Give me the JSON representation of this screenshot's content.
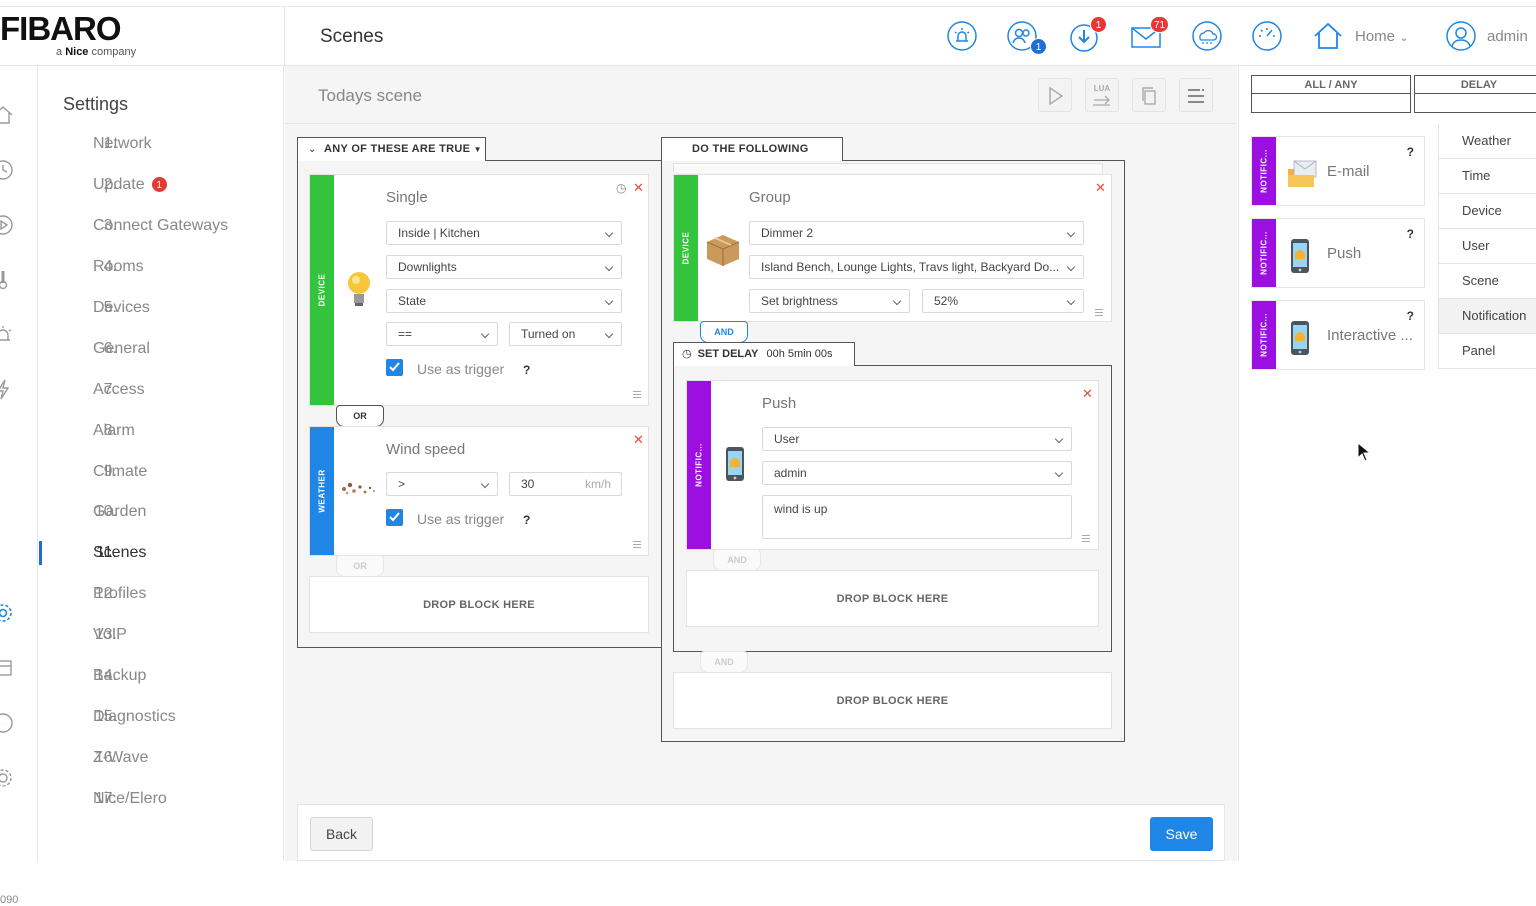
{
  "header": {
    "brand": "FIBARO",
    "brand_sub_prefix": "a ",
    "brand_sub_strong": "Nice",
    "brand_sub_suffix": " company",
    "page_title": "Scenes",
    "icons": [
      "alarm-icon",
      "users-icon",
      "download-icon",
      "mail-icon",
      "weather-icon",
      "gauge-icon",
      "home-icon",
      "user-icon"
    ],
    "users_badge": "1",
    "download_badge": "1",
    "mail_badge": "71",
    "home_label": "Home",
    "user_label": "admin"
  },
  "icon_strip": {
    "icons": [
      "home-icon",
      "clock-icon",
      "scene-icon",
      "thermometer-icon",
      "alarm-icon",
      "energy-icon",
      "settings-icon",
      "panel-icon",
      "chat-icon",
      "gear-icon"
    ],
    "footer_text": "090"
  },
  "settings": {
    "title": "Settings",
    "items": [
      {
        "num": "1.",
        "label": "Network"
      },
      {
        "num": "2.",
        "label": "Update",
        "badge": "1"
      },
      {
        "num": "3.",
        "label": "Connect Gateways"
      },
      {
        "num": "4.",
        "label": "Rooms"
      },
      {
        "num": "5.",
        "label": "Devices"
      },
      {
        "num": "6.",
        "label": "General"
      },
      {
        "num": "7.",
        "label": "Access"
      },
      {
        "num": "8.",
        "label": "Alarm"
      },
      {
        "num": "9.",
        "label": "Climate"
      },
      {
        "num": "10.",
        "label": "Garden"
      },
      {
        "num": "11.",
        "label": "Scenes"
      },
      {
        "num": "12.",
        "label": "Profiles"
      },
      {
        "num": "13.",
        "label": "VoIP"
      },
      {
        "num": "14.",
        "label": "Backup"
      },
      {
        "num": "15.",
        "label": "Diagnostics"
      },
      {
        "num": "16.",
        "label": "Z-Wave"
      },
      {
        "num": "17.",
        "label": "Nice/Elero"
      }
    ],
    "active_index": 10
  },
  "scene": {
    "name": "Todays scene",
    "tools": [
      "play-icon",
      "lua-icon",
      "copy-icon",
      "list-icon"
    ],
    "lua_label": "LUA"
  },
  "conditions": {
    "header": "ANY OF THESE ARE TRUE",
    "device_block": {
      "stripe": "DEVICE",
      "title": "Single",
      "room": "Inside | Kitchen",
      "device": "Downlights",
      "property": "State",
      "operator": "==",
      "value": "Turned on",
      "trigger_label": "Use as trigger",
      "help": "?"
    },
    "or_label": "OR",
    "weather_block": {
      "stripe": "WEATHER",
      "title": "Wind speed",
      "operator": ">",
      "value": "30",
      "unit": "km/h",
      "trigger_label": "Use as trigger",
      "help": "?"
    },
    "faded_or_label": "OR",
    "drop_label": "DROP BLOCK HERE"
  },
  "actions": {
    "header": "DO THE FOLLOWING",
    "group_block": {
      "stripe": "DEVICE",
      "title": "Group",
      "type": "Dimmer 2",
      "devices": "Island Bench, Lounge Lights, Travs light, Backyard Do...",
      "action": "Set brightness",
      "value": "52%"
    },
    "and_label": "AND",
    "delay": {
      "label": "SET DELAY",
      "value": "00h 5min 00s"
    },
    "push_block": {
      "stripe": "NOTIFIC...",
      "title": "Push",
      "target_type": "User",
      "target": "admin",
      "message": "wind is up"
    },
    "inner_and_label": "AND",
    "inner_drop_label": "DROP BLOCK HERE",
    "outer_and_label": "AND",
    "outer_drop_label": "DROP BLOCK HERE"
  },
  "footer": {
    "back_label": "Back",
    "save_label": "Save"
  },
  "palette": {
    "tabs": [
      "ALL / ANY",
      "DELAY"
    ],
    "cards": [
      {
        "stripe": "NOTIFIC...",
        "label": "E-mail",
        "help": "?",
        "icon": "email-icon"
      },
      {
        "stripe": "NOTIFIC...",
        "label": "Push",
        "help": "?",
        "icon": "phone-icon"
      },
      {
        "stripe": "NOTIFIC...",
        "label": "Interactive ...",
        "help": "?",
        "icon": "phone-icon"
      }
    ],
    "categories": [
      "Weather",
      "Time",
      "Device",
      "User",
      "Scene",
      "Notification",
      "Panel"
    ],
    "active_category": "Notification"
  },
  "colors": {
    "accent": "#1f86e5",
    "device": "#33c33c",
    "weather": "#1f86e5",
    "notification": "#9b10e0",
    "badge": "#e53935"
  }
}
